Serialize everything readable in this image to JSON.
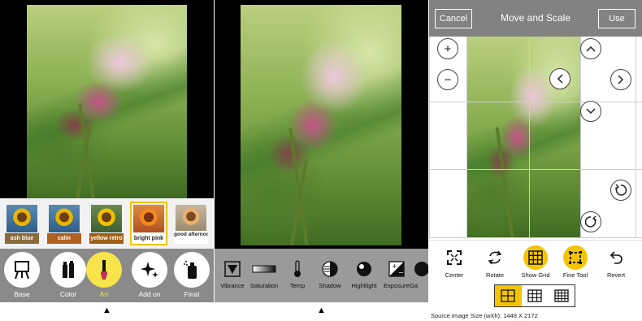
{
  "panel1": {
    "filters": [
      {
        "label": "ash blue"
      },
      {
        "label": "calm"
      },
      {
        "label": "yellow retro"
      },
      {
        "label": "bright pink",
        "selected": true
      },
      {
        "label": "good afternoon"
      }
    ],
    "tools": [
      {
        "label": "Base",
        "icon": "easel-icon"
      },
      {
        "label": "Color",
        "icon": "paint-tubes-icon"
      },
      {
        "label": "Art",
        "icon": "brush-icon",
        "active": true
      },
      {
        "label": "Add on",
        "icon": "sparkle-icon"
      },
      {
        "label": "Final",
        "icon": "spray-can-icon"
      }
    ],
    "indicator": "▲"
  },
  "panel2": {
    "adjustments": [
      {
        "label": "Vibrance",
        "icon": "triangle-down-icon"
      },
      {
        "label": "Saturation",
        "icon": "gradient-bar-icon"
      },
      {
        "label": "Temp",
        "icon": "thermometer-icon"
      },
      {
        "label": "Shadow",
        "icon": "shadow-circle-icon"
      },
      {
        "label": "Hightlight",
        "icon": "highlight-circle-icon"
      },
      {
        "label": "Exposure",
        "icon": "exposure-icon"
      },
      {
        "label": "Ga",
        "icon": "gamma-icon"
      }
    ],
    "indicator": "▲"
  },
  "panel3": {
    "header": {
      "cancel": "Cancel",
      "title": "Move and Scale",
      "use": "Use"
    },
    "canvas_buttons": {
      "zoom_in": "+",
      "zoom_out": "−",
      "up": "^",
      "left": "<",
      "right": ">",
      "down": "v"
    },
    "tools": [
      {
        "label": "Center",
        "icon": "center-icon"
      },
      {
        "label": "Rotate",
        "icon": "rotate-icon"
      },
      {
        "label": "Show Grid",
        "icon": "grid-icon",
        "active": true
      },
      {
        "label": "Fine Tool",
        "icon": "fine-tool-icon",
        "active": true
      },
      {
        "label": "Revert",
        "icon": "revert-icon"
      }
    ],
    "grid_options": [
      {
        "name": "2x2",
        "selected": true
      },
      {
        "name": "3x3"
      },
      {
        "name": "4x4"
      }
    ],
    "source_size": "Source Image Size (wXh): 1448 X 2172"
  },
  "colors": {
    "accent": "#f5c400",
    "toolbar_gray": "#8a8a8a",
    "header_gray": "#828282"
  }
}
